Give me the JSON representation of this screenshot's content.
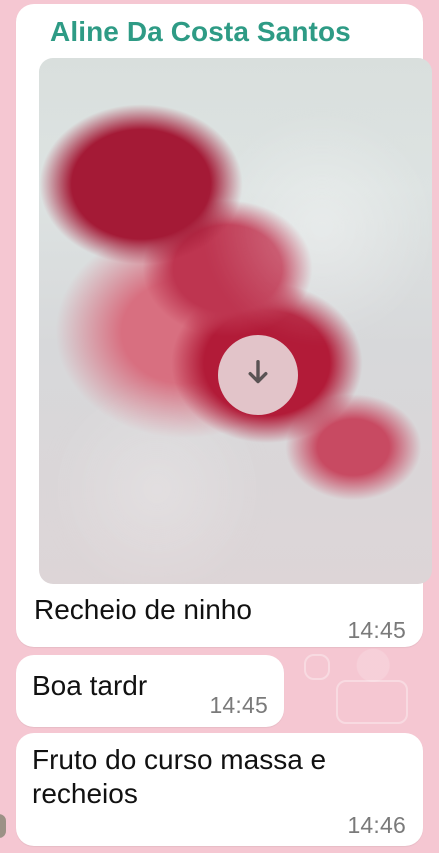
{
  "chat": {
    "sender_name": "Aline Da Costa Santos",
    "media_message": {
      "caption": "Recheio de ninho",
      "time": "14:45",
      "download_icon": "download-arrow-icon"
    },
    "messages": [
      {
        "text": "Boa tardr",
        "time": "14:45"
      },
      {
        "text": "Fruto do curso massa e recheios",
        "time": "14:46"
      }
    ]
  },
  "colors": {
    "wallpaper": "#f5c7d2",
    "sender_name": "#2e9b85",
    "bubble": "#ffffff",
    "time": "#7a7a7a"
  }
}
